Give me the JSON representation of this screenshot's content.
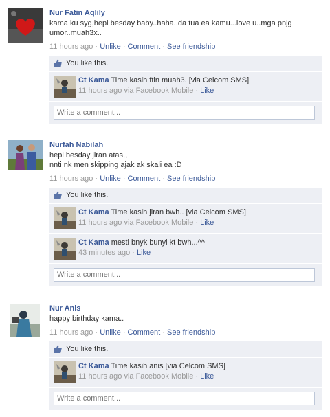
{
  "posts": [
    {
      "author": "Nur Fatin Aqlily",
      "message": "kama ku syg,hepi besday baby..haha..da tua ea kamu...love u..mga pnjg umor..muah3x..",
      "time": "11 hours ago",
      "unlike": "Unlike",
      "comment": "Comment",
      "see_friendship": "See friendship",
      "likes": "You like this.",
      "comments": [
        {
          "name": "Ct Kama",
          "text": "Time kasih ftin muah3. [via Celcom SMS]",
          "time": "11 hours ago via Facebook Mobile",
          "like": "Like"
        }
      ],
      "write_placeholder": "Write a comment..."
    },
    {
      "author": "Nurfah Nabilah",
      "message": "hepi besday jiran atas,,\nnnti nk men skipping ajak ak skali ea :D",
      "time": "11 hours ago",
      "unlike": "Unlike",
      "comment": "Comment",
      "see_friendship": "See friendship",
      "likes": "You like this.",
      "comments": [
        {
          "name": "Ct Kama",
          "text": "Time kasih jiran bwh.. [via Celcom SMS]",
          "time": "11 hours ago via Facebook Mobile",
          "like": "Like"
        },
        {
          "name": "Ct Kama",
          "text": "mesti bnyk bunyi kt bwh...^^",
          "time": "43 minutes ago",
          "like": "Like"
        }
      ],
      "write_placeholder": "Write a comment..."
    },
    {
      "author": "Nur Anis",
      "message": "happy birthday kama..",
      "time": "11 hours ago",
      "unlike": "Unlike",
      "comment": "Comment",
      "see_friendship": "See friendship",
      "likes": "You like this.",
      "comments": [
        {
          "name": "Ct Kama",
          "text": "Time kasih anis [via Celcom SMS]",
          "time": "11 hours ago via Facebook Mobile",
          "like": "Like"
        }
      ],
      "write_placeholder": "Write a comment..."
    }
  ],
  "separator": " · ",
  "colors": {
    "link": "#3b5998",
    "meta": "#999999",
    "ufi_bg": "#edeff4"
  },
  "icons": {
    "like": "thumbs-up-icon"
  }
}
